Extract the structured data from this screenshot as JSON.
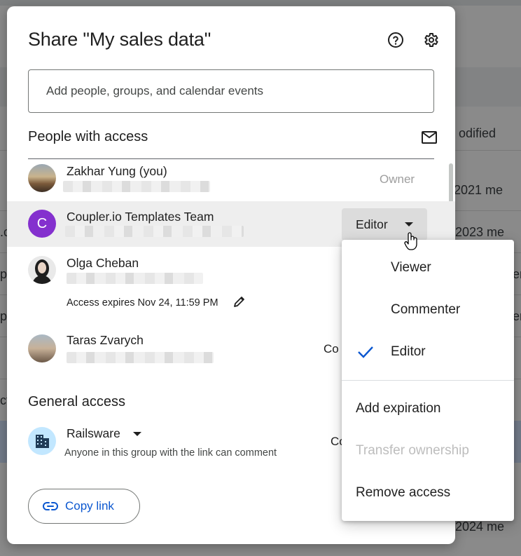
{
  "background": {
    "column_header": "odified",
    "rows": [
      {
        "text": "2021 me"
      },
      {
        "text": "2023 me"
      },
      {
        "text": "2024 me"
      }
    ],
    "left_fragments": [
      ".c",
      "p",
      "p",
      "ct"
    ],
    "right_fragments": [
      "er",
      "er"
    ]
  },
  "dialog": {
    "title": "Share \"My sales data\"",
    "help_icon": "help-circle-icon",
    "settings_icon": "gear-icon",
    "add_people_placeholder": "Add people, groups, and calendar events",
    "people_section_title": "People with access",
    "mail_icon": "envelope-icon",
    "people": [
      {
        "name": "Zakhar Yung (you)",
        "role": "Owner"
      },
      {
        "name": "Coupler.io Templates Team",
        "avatar_letter": "C",
        "avatar_color": "#8430ce",
        "role": "Editor"
      },
      {
        "name": "Olga Cheban",
        "expires": "Access expires Nov 24, 11:59 PM"
      },
      {
        "name": "Taras Zvarych",
        "role_partial": "Co"
      }
    ],
    "general_access_title": "General access",
    "general_access": {
      "name": "Railsware",
      "description": "Anyone in this group with the link can comment",
      "role_partial": "Co"
    },
    "copy_link_label": "Copy link"
  },
  "role_menu": {
    "items": [
      {
        "label": "Viewer",
        "selected": false
      },
      {
        "label": "Commenter",
        "selected": false
      },
      {
        "label": "Editor",
        "selected": true
      }
    ],
    "actions": [
      {
        "label": "Add expiration",
        "disabled": false
      },
      {
        "label": "Transfer ownership",
        "disabled": true
      },
      {
        "label": "Remove access",
        "disabled": false
      }
    ]
  },
  "colors": {
    "accent": "#0b57d0",
    "scrim": "rgba(0,0,0,0.46)"
  }
}
